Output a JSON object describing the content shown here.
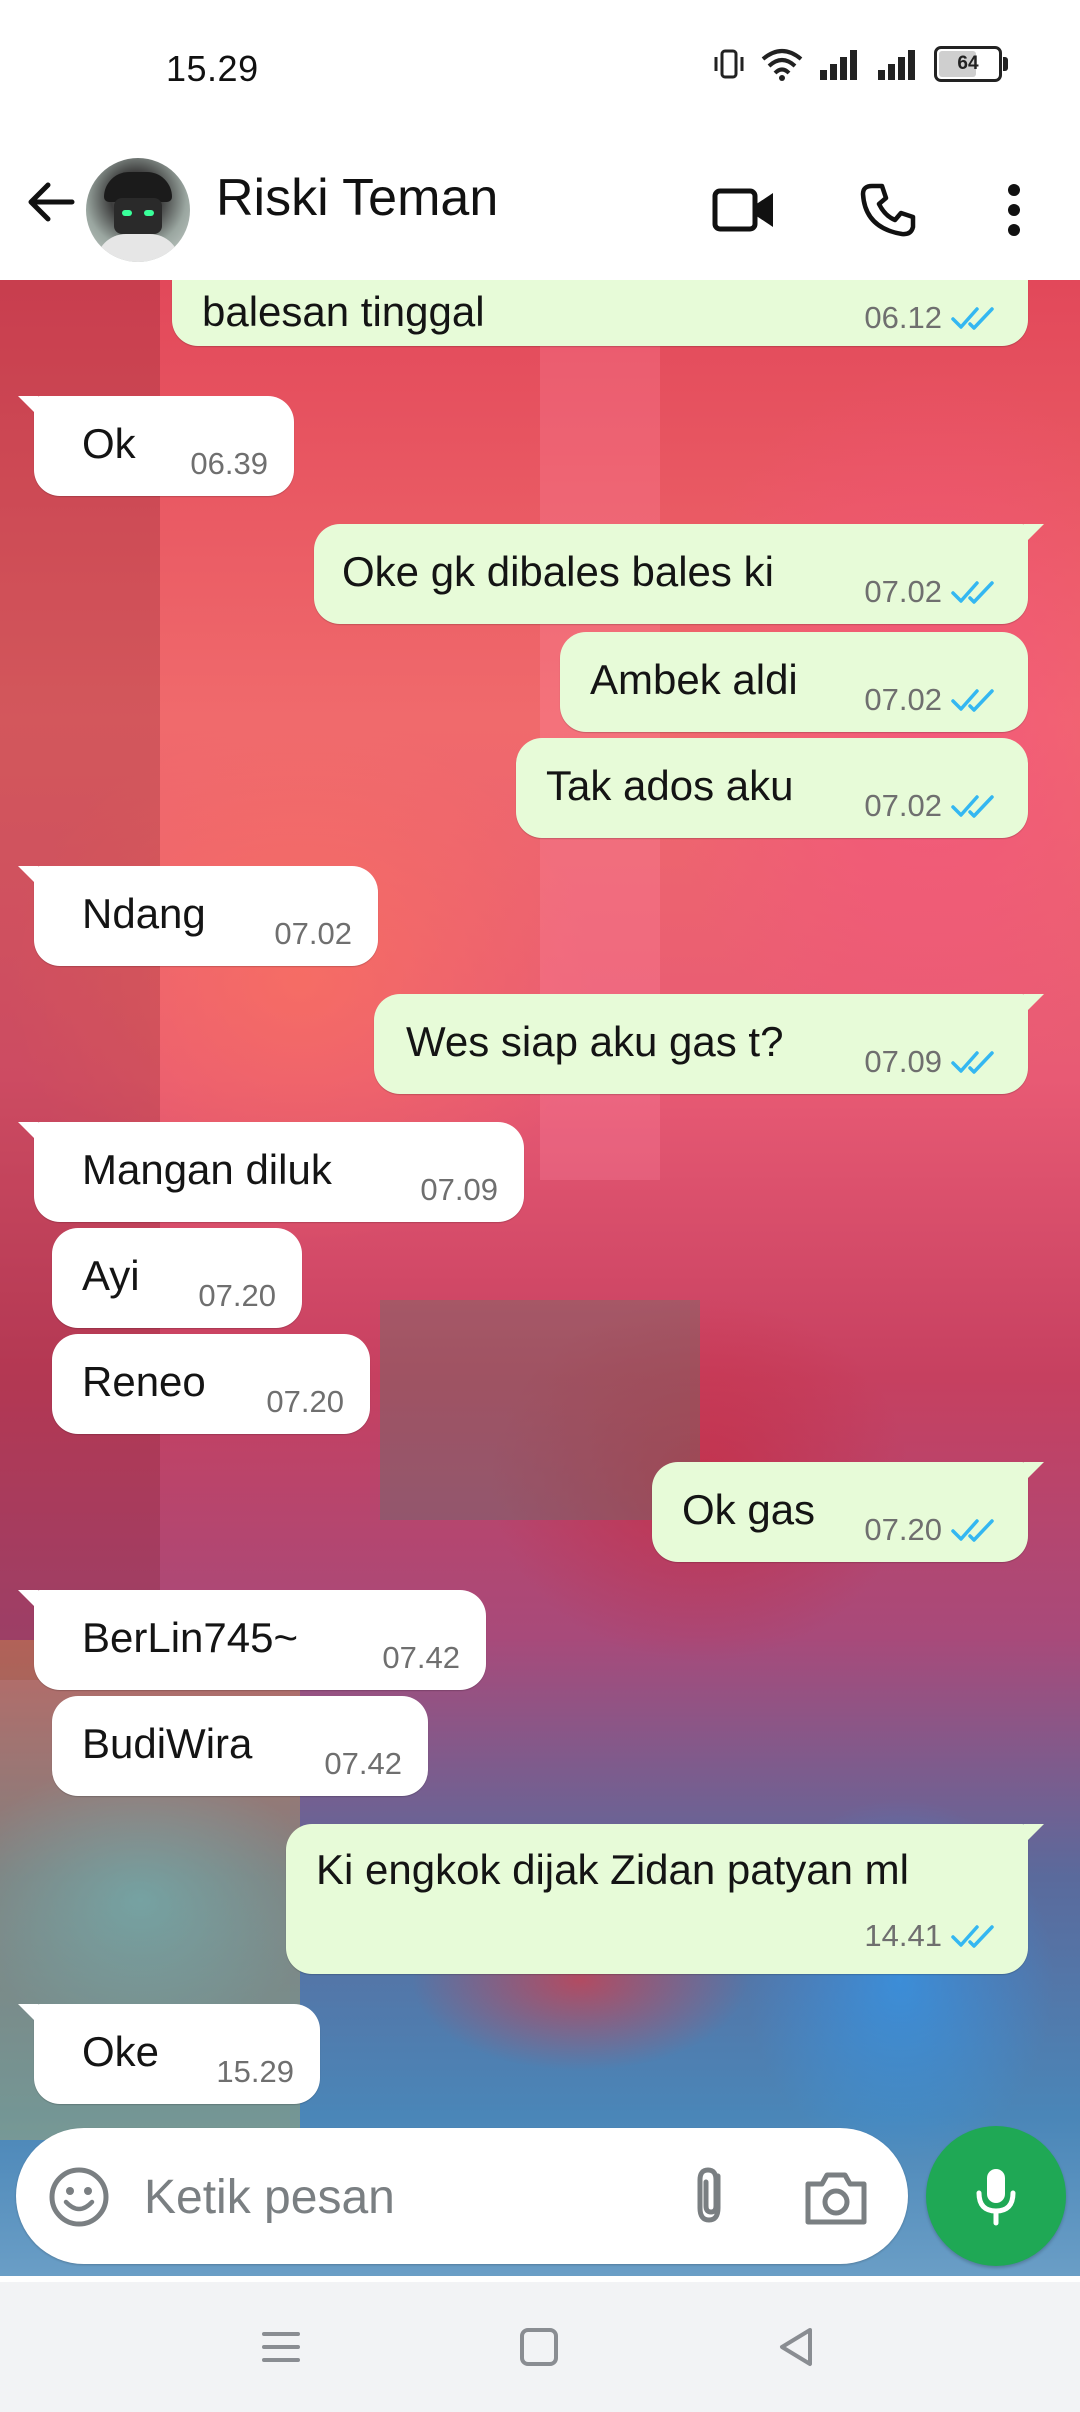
{
  "status_bar": {
    "time": "15.29",
    "battery": "64",
    "battery_level_percent": 64
  },
  "header": {
    "contact_name": "Riski Teman",
    "icons": [
      "back-arrow-icon",
      "video-call-icon",
      "voice-call-icon",
      "more-options-icon"
    ]
  },
  "messages": [
    {
      "dir": "out",
      "text": "balesan tinggal",
      "time": "06.12",
      "read": true
    },
    {
      "dir": "in",
      "text": "Ok",
      "time": "06.39"
    },
    {
      "dir": "out",
      "text": "Oke gk dibales bales ki",
      "time": "07.02",
      "read": true
    },
    {
      "dir": "out",
      "text": "Ambek aldi",
      "time": "07.02",
      "read": true
    },
    {
      "dir": "out",
      "text": "Tak ados aku",
      "time": "07.02",
      "read": true
    },
    {
      "dir": "in",
      "text": "Ndang",
      "time": "07.02"
    },
    {
      "dir": "out",
      "text": "Wes siap aku gas t?",
      "time": "07.09",
      "read": true
    },
    {
      "dir": "in",
      "text": "Mangan diluk",
      "time": "07.09"
    },
    {
      "dir": "in",
      "text": "Ayi",
      "time": "07.20"
    },
    {
      "dir": "in",
      "text": "Reneo",
      "time": "07.20"
    },
    {
      "dir": "out",
      "text": "Ok gas",
      "time": "07.20",
      "read": true
    },
    {
      "dir": "in",
      "text": "BerLin745~",
      "time": "07.42"
    },
    {
      "dir": "in",
      "text": "BudiWira",
      "time": "07.42"
    },
    {
      "dir": "out",
      "text": "Ki engkok dijak Zidan patyan ml",
      "time": "14.41",
      "read": true
    },
    {
      "dir": "in",
      "text": "Oke",
      "time": "15.29"
    }
  ],
  "composer": {
    "placeholder": "Ketik pesan"
  },
  "colors": {
    "outgoing_bubble": "#e7fbd8",
    "incoming_bubble": "#ffffff",
    "read_tick": "#34b7f1",
    "mic_button": "#1fa855"
  }
}
